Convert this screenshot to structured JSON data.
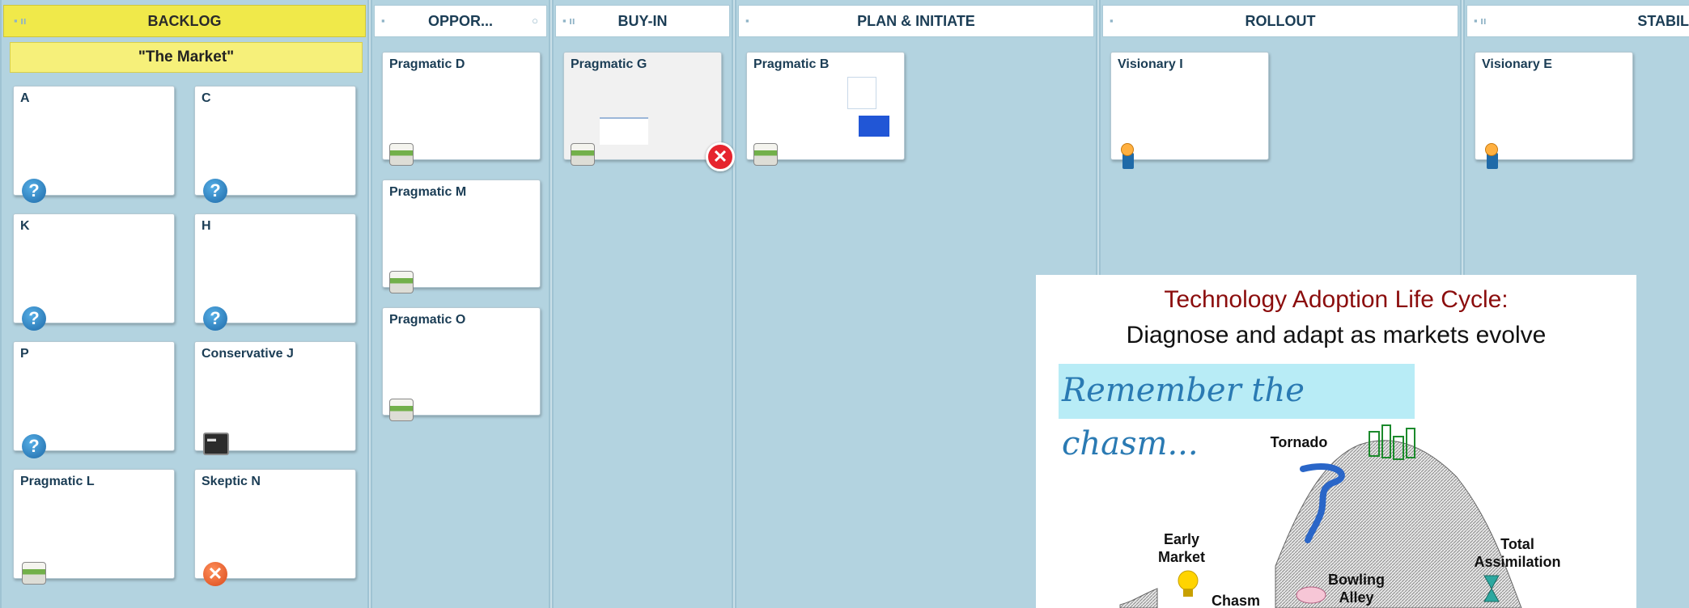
{
  "columns": {
    "backlog": {
      "title": "BACKLOG",
      "subtitle": "\"The Market\""
    },
    "opportunity": {
      "title": "OPPOR..."
    },
    "buyin": {
      "title": "BUY-IN"
    },
    "plan": {
      "title": "PLAN & INITIATE"
    },
    "rollout": {
      "title": "ROLLOUT"
    },
    "stabilize": {
      "title": "STABILIZ"
    }
  },
  "cards": {
    "backlog": [
      {
        "label": "A",
        "icon": "question-icon"
      },
      {
        "label": "C",
        "icon": "question-icon"
      },
      {
        "label": "K",
        "icon": "question-icon"
      },
      {
        "label": "H",
        "icon": "question-icon"
      },
      {
        "label": "P",
        "icon": "question-icon"
      },
      {
        "label": "Conservative J",
        "icon": "terminal-icon"
      },
      {
        "label": "Pragmatic L",
        "icon": "tray-icon"
      },
      {
        "label": "Skeptic N",
        "icon": "reject-icon"
      }
    ],
    "opportunity": [
      {
        "label": "Pragmatic D",
        "icon": "tray-icon"
      },
      {
        "label": "Pragmatic M",
        "icon": "tray-icon"
      },
      {
        "label": "Pragmatic O",
        "icon": "tray-icon"
      }
    ],
    "buyin": [
      {
        "label": "Pragmatic G",
        "icon": "tray-icon"
      }
    ],
    "plan": [
      {
        "label": "Pragmatic B",
        "icon": "tray-icon"
      }
    ],
    "rollout": [
      {
        "label": "Visionary I",
        "icon": "pin-icon"
      }
    ],
    "stabilize": [
      {
        "label": "Visionary E",
        "icon": "pin-icon"
      }
    ]
  },
  "overlay": {
    "title": "Technology Adoption Life Cycle:",
    "subtitle": "Diagnose and adapt as markets evolve",
    "remember": "Remember the chasm...",
    "labels": {
      "tornado": "Tornado",
      "early_market": "Early Market",
      "total_assimilation": "Total Assimilation",
      "bowling_alley": "Bowling Alley",
      "chasm": "Chasm"
    }
  },
  "colors": {
    "board_bg": "#b3d3e0",
    "backlog_header": "#f0e94a",
    "overlay_title": "#8b0d0d",
    "remember_text": "#2a7ab3"
  }
}
